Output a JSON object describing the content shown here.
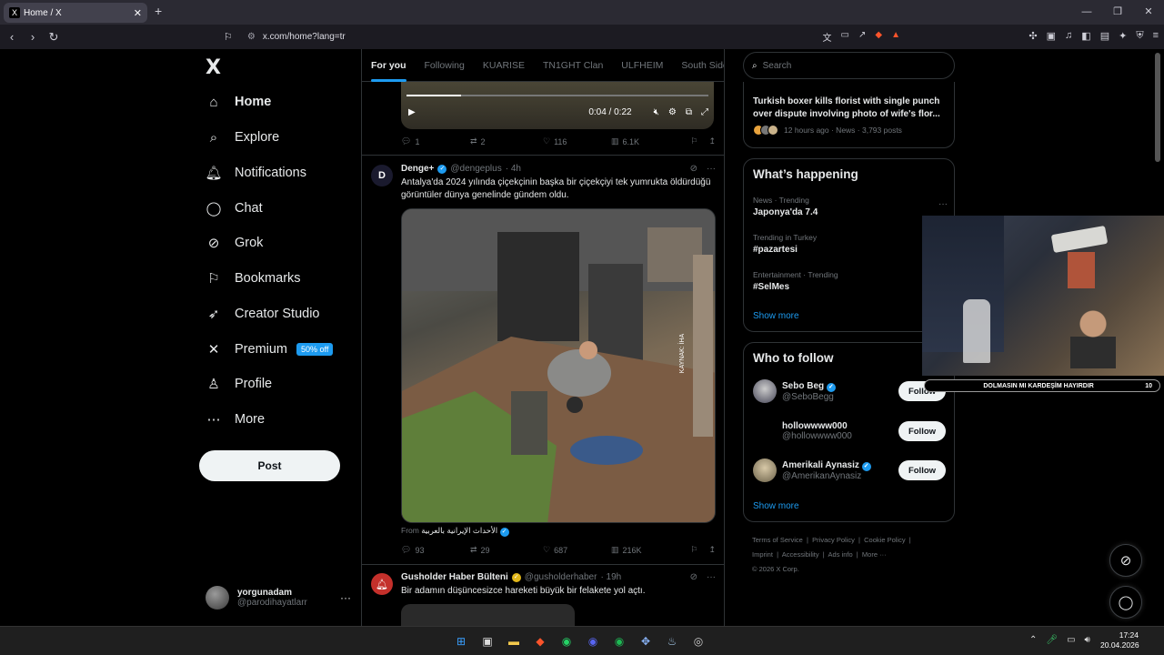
{
  "browser": {
    "tab_title": "Home / X",
    "tab_favicon": "X",
    "tab_close": "✕",
    "new_tab": "+",
    "url": "x.com/home?lang=tr",
    "window_controls": [
      "—",
      "❐",
      "✕"
    ]
  },
  "nav": {
    "logo": "X",
    "items": [
      {
        "label": "Home",
        "icon": "home-icon",
        "glyph": "⌂"
      },
      {
        "label": "Explore",
        "icon": "search-icon",
        "glyph": "⌕"
      },
      {
        "label": "Notifications",
        "icon": "bell-icon",
        "glyph": "🔔︎"
      },
      {
        "label": "Chat",
        "icon": "chat-icon",
        "glyph": "◯"
      },
      {
        "label": "Grok",
        "icon": "grok-icon",
        "glyph": "⊘"
      },
      {
        "label": "Bookmarks",
        "icon": "bookmark-icon",
        "glyph": "⚐"
      },
      {
        "label": "Creator Studio",
        "icon": "rocket-icon",
        "glyph": "➶"
      },
      {
        "label": "Premium",
        "icon": "x-premium-icon",
        "glyph": "✕"
      },
      {
        "label": "Profile",
        "icon": "person-icon",
        "glyph": "♙"
      },
      {
        "label": "More",
        "icon": "more-circle-icon",
        "glyph": "⋯"
      }
    ],
    "premium_badge": "50% off",
    "post_button": "Post",
    "account": {
      "name": "yorgunadam",
      "handle": "@parodihayatlarr",
      "more": "···"
    }
  },
  "feed": {
    "tabs": [
      "For you",
      "Following",
      "KUARISE",
      "TN1GHT Clan",
      "ULFHEIM",
      "South Side"
    ],
    "video_top": {
      "time": "0:04 / 0:22",
      "progress": 0.18
    },
    "first_tweet_actions": {
      "replies": "1",
      "reposts": "2",
      "likes": "116",
      "views": "6.1K"
    },
    "tweet": {
      "name": "Denge+",
      "handle": "@dengeplus",
      "time": "· 4h",
      "text": "Antalya'da 2024 yılında çiçekçinin başka bir çiçekçiyi tek yumrukta öldürdüğü görüntüler dünya genelinde gündem oldu.",
      "media_watermark": "KAYNAK: İHA",
      "from_label": "From",
      "from_source": "الأحداث الإيرانية بالعربية",
      "replies": "93",
      "reposts": "29",
      "likes": "687",
      "views": "216K"
    },
    "tweet2": {
      "name": "Gusholder Haber Bülteni",
      "handle": "@gusholderhaber",
      "time": "· 19h",
      "text": "Bir adamın düşüncesizce hareketi büyük bir felakete yol açtı."
    }
  },
  "right": {
    "search_placeholder": "Search",
    "news": {
      "title": "Turkish boxer kills florist with single punch over dispute involving photo of wife's flor...",
      "meta": "12 hours ago · News · 3,793 posts"
    },
    "happening": {
      "title": "What’s happening",
      "trends": [
        {
          "category": "News · Trending",
          "name": "Japonya'da 7.4"
        },
        {
          "category": "Trending in Turkey",
          "name": "#pazartesi"
        },
        {
          "category": "Entertainment · Trending",
          "name": "#SelMes"
        }
      ],
      "show_more": "Show more"
    },
    "who_to_follow": {
      "title": "Who to follow",
      "users": [
        {
          "name": "Sebo Beg",
          "handle": "@SeboBegg",
          "button": "Follow"
        },
        {
          "name": "hollowwww000",
          "handle": "@hollowwww000",
          "button": "Follow"
        },
        {
          "name": "Amerikali Aynasiz",
          "handle": "@AmerikanAynasiz",
          "button": "Follow"
        }
      ],
      "show_more": "Show more"
    },
    "footer": [
      "Terms of Service",
      "Privacy Policy",
      "Cookie Policy",
      "Imprint",
      "Accessibility",
      "Ads info",
      "More ···",
      "© 2026 X Corp."
    ]
  },
  "overlay": {
    "banner_text": "DOLMASIN MI KARDEŞİM HAYIRDIR",
    "banner_count": "10"
  },
  "taskbar": {
    "time": "17:24",
    "date": "20.04.2026"
  },
  "colors": {
    "accent": "#1d9bf0",
    "background": "#000000",
    "border": "#2f3336",
    "muted": "#71767b"
  }
}
